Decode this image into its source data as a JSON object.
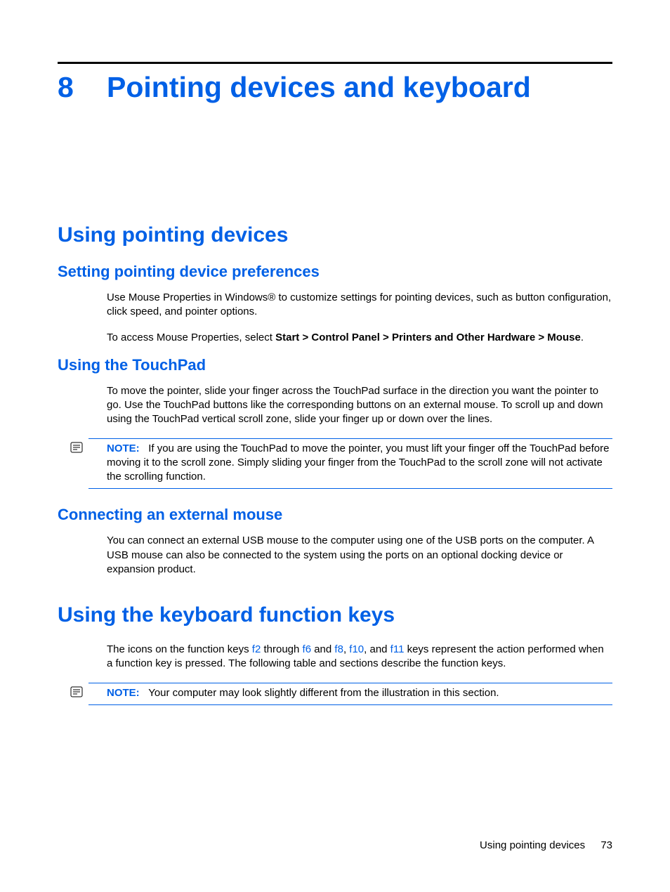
{
  "chapter": {
    "number": "8",
    "title": "Pointing devices and keyboard"
  },
  "section1": {
    "title": "Using pointing devices",
    "sub1": {
      "title": "Setting pointing device preferences",
      "p1": "Use Mouse Properties in Windows® to customize settings for pointing devices, such as button configuration, click speed, and pointer options.",
      "p2_pre": "To access Mouse Properties, select ",
      "p2_bold": "Start > Control Panel > Printers and Other Hardware > Mouse",
      "p2_post": "."
    },
    "sub2": {
      "title": "Using the TouchPad",
      "p1": "To move the pointer, slide your finger across the TouchPad surface in the direction you want the pointer to go. Use the TouchPad buttons like the corresponding buttons on an external mouse. To scroll up and down using the TouchPad vertical scroll zone, slide your finger up or down over the lines.",
      "note_label": "NOTE:",
      "note_text": "If you are using the TouchPad to move the pointer, you must lift your finger off the TouchPad before moving it to the scroll zone. Simply sliding your finger from the TouchPad to the scroll zone will not activate the scrolling function."
    },
    "sub3": {
      "title": "Connecting an external mouse",
      "p1": "You can connect an external USB mouse to the computer using one of the USB ports on the computer. A USB mouse can also be connected to the system using the ports on an optional docking device or expansion product."
    }
  },
  "section2": {
    "title": "Using the keyboard function keys",
    "p1_pre": "The icons on the function keys ",
    "f2": "f2",
    "p1_mid1": " through ",
    "f6": "f6",
    "p1_mid2": " and ",
    "f8": "f8",
    "p1_mid3": ", ",
    "f10": "f10",
    "p1_mid4": ", and ",
    "f11": "f11",
    "p1_post": " keys represent the action performed when a function key is pressed. The following table and sections describe the function keys.",
    "note_label": "NOTE:",
    "note_text": "Your computer may look slightly different from the illustration in this section."
  },
  "footer": {
    "text": "Using pointing devices",
    "page": "73"
  }
}
